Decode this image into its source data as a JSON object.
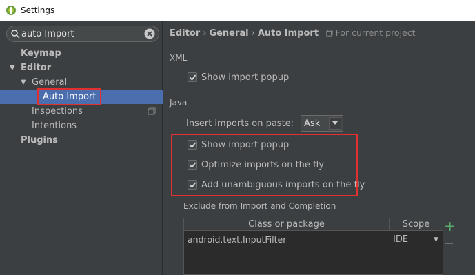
{
  "window": {
    "title": "Settings"
  },
  "search": {
    "value": "auto Import"
  },
  "sidebar": {
    "items": [
      {
        "label": "Keymap"
      },
      {
        "label": "Editor"
      },
      {
        "label": "General"
      },
      {
        "label": "Auto Import"
      },
      {
        "label": "Inspections"
      },
      {
        "label": "Intentions"
      },
      {
        "label": "Plugins"
      }
    ]
  },
  "breadcrumb": {
    "part1": "Editor",
    "part2": "General",
    "part3": "Auto Import",
    "separator": "›",
    "scope": "For current project"
  },
  "xml": {
    "heading": "XML",
    "show_popup": {
      "label": "Show import popup",
      "checked": true
    }
  },
  "java": {
    "heading": "Java",
    "paste_label": "Insert imports on paste:",
    "paste_value": "Ask",
    "show_popup": {
      "label": "Show import popup",
      "checked": true
    },
    "optimize": {
      "label": "Optimize imports on the fly",
      "checked": true
    },
    "unambiguous": {
      "label": "Add unambiguous imports on the fly",
      "checked": true
    }
  },
  "exclude": {
    "heading": "Exclude from Import and Completion",
    "col_class": "Class or package",
    "col_scope": "Scope",
    "rows": [
      {
        "name": "android.text.InputFilter",
        "scope": "IDE"
      }
    ],
    "add_label": "+"
  },
  "colors": {
    "background": "#3c3f41",
    "selection": "#4b6eaf",
    "highlight_border": "#e03030",
    "add_green": "#59a869"
  }
}
